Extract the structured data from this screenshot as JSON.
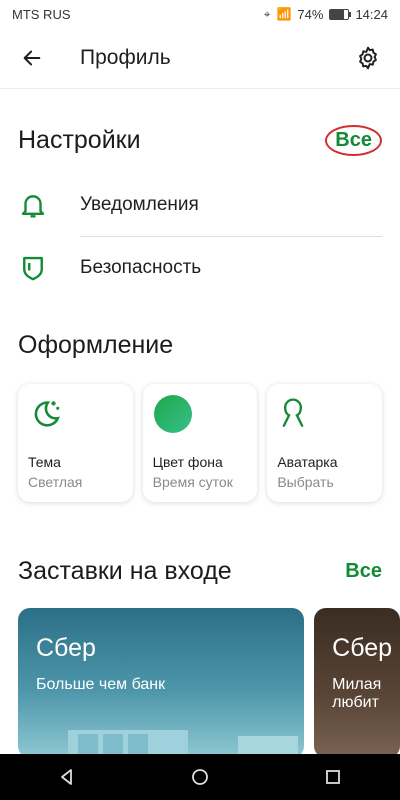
{
  "status_bar": {
    "carrier": "MTS RUS",
    "battery": "74%",
    "time": "14:24"
  },
  "app_bar": {
    "title": "Профиль"
  },
  "settings": {
    "title": "Настройки",
    "all_label": "Все",
    "items": [
      {
        "label": "Уведомления",
        "icon": "bell-icon"
      },
      {
        "label": "Безопасность",
        "icon": "shield-icon"
      }
    ]
  },
  "appearance": {
    "title": "Оформление",
    "cards": [
      {
        "title": "Тема",
        "subtitle": "Светлая",
        "icon": "moon-stars-icon"
      },
      {
        "title": "Цвет фона",
        "subtitle": "Время суток",
        "icon": "color-circle-icon"
      },
      {
        "title": "Аватарка",
        "subtitle": "Выбрать",
        "icon": "avatar-icon"
      }
    ]
  },
  "screensavers": {
    "title": "Заставки на входе",
    "all_label": "Все",
    "banners": [
      {
        "title": "Сбер",
        "subtitle": "Больше чем банк"
      },
      {
        "title": "Сбер",
        "subtitle": "Милая\nлюбит"
      }
    ]
  },
  "colors": {
    "accent": "#138a36",
    "highlight": "#d32f2f"
  }
}
